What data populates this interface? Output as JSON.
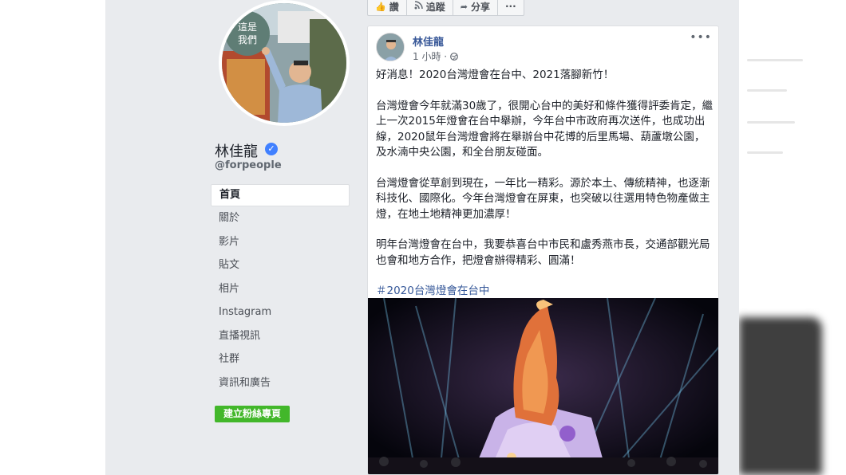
{
  "profile": {
    "name": "林佳龍",
    "handle": "@forpeople",
    "avatar_sign_text": "這是\n我們"
  },
  "nav": {
    "items": [
      "首頁",
      "關於",
      "影片",
      "貼文",
      "相片",
      "Instagram",
      "直播視訊",
      "社群",
      "資訊和廣告"
    ],
    "active": "首頁"
  },
  "create_button": "建立粉絲專頁",
  "action_bar": {
    "like": "讚",
    "follow": "追蹤",
    "share": "分享",
    "more": "···"
  },
  "post": {
    "author": "林佳龍",
    "time": "1 小時 ·",
    "privacy_icon": "globe-icon",
    "more": "•••",
    "paragraphs": [
      "好消息！2020台灣燈會在台中、2021落腳新竹！",
      "台灣燈會今年就滿30歲了，很開心台中的美好和條件獲得評委肯定，繼上一次2015年燈會在台中舉辦，今年台中市政府再次送件，也成功出線，2020鼠年台灣燈會將在舉辦台中花博的后里馬場、葫蘆墩公園，及水湳中央公園，和全台朋友碰面。",
      "台灣燈會從草創到現在，一年比一精彩。源於本土、傳統精神，也逐漸科技化、國際化。今年台灣燈會在屏東，也突破以往選用特色物產做主燈，在地土地精神更加濃厚！",
      "明年台灣燈會在台中，我要恭喜台中市民和盧秀燕市長，交通部觀光局也會和地方合作，把燈會辦得精彩、圓滿！"
    ],
    "hashtag": "＃2020台灣燈會在台中"
  },
  "colors": {
    "link": "#385898",
    "green": "#42b72a",
    "verified": "#4080ff",
    "background": "#e9ebee"
  }
}
